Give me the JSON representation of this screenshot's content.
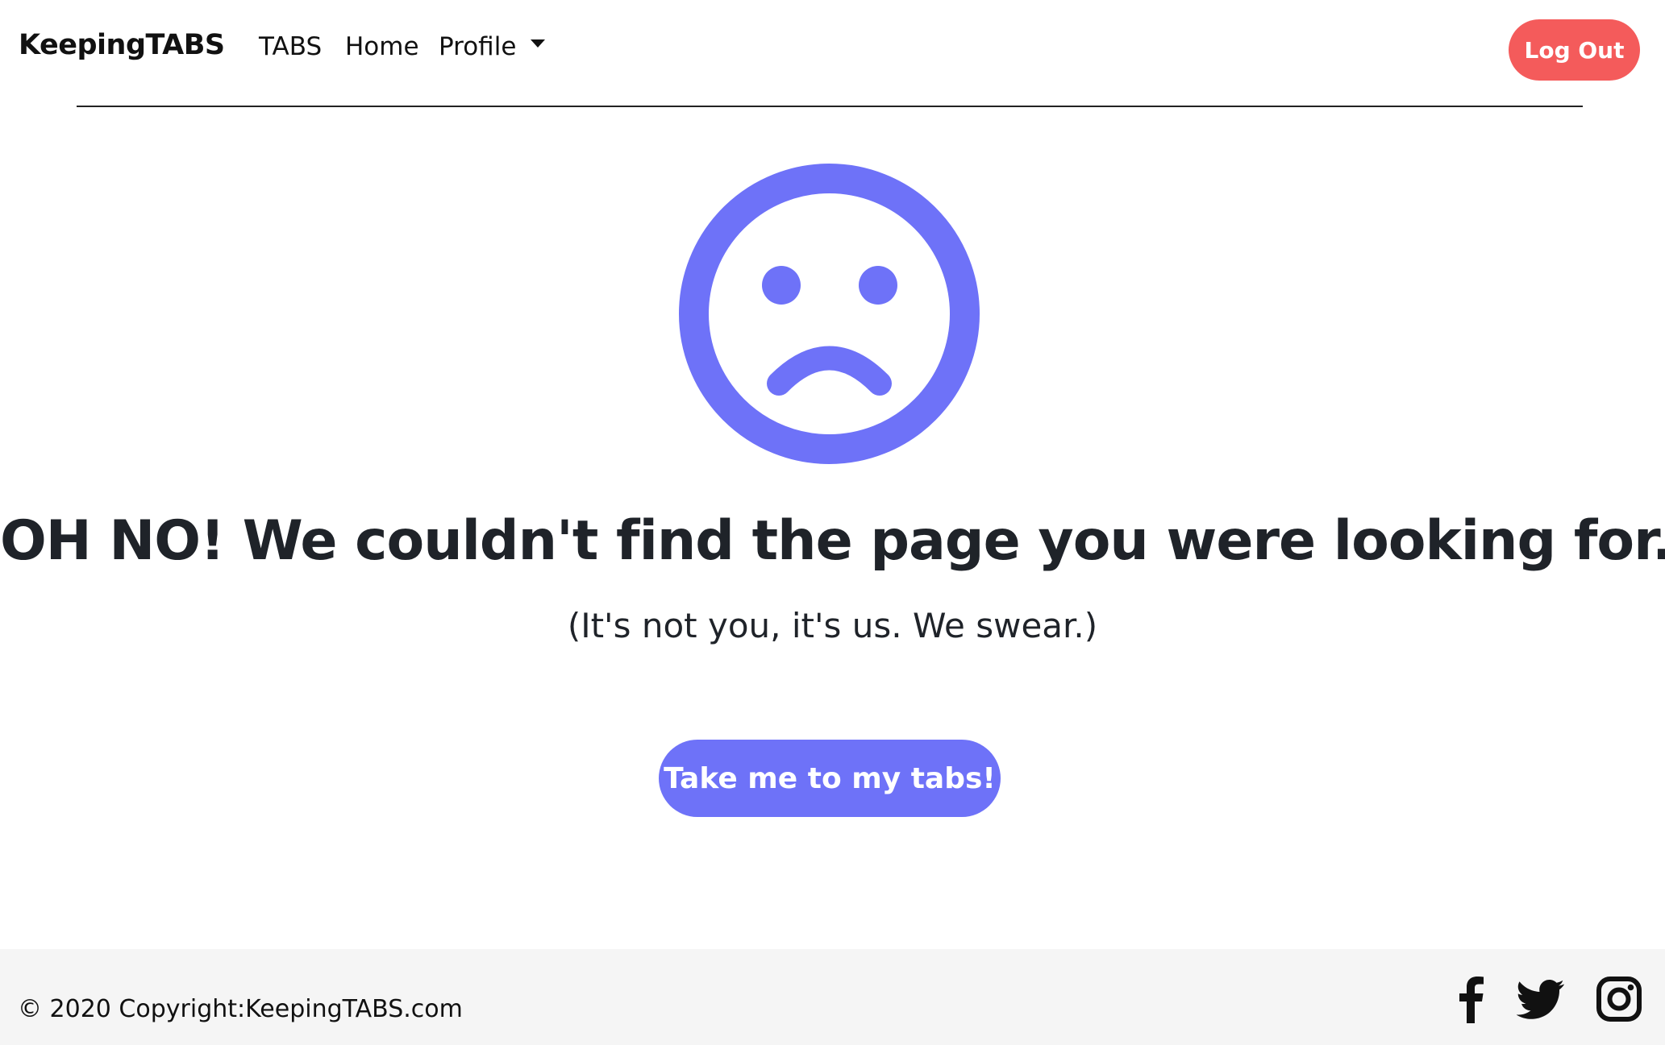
{
  "navbar": {
    "brand": "KeepingTABS",
    "links": [
      {
        "label": "TABS"
      },
      {
        "label": "Home"
      },
      {
        "label": "Profile"
      }
    ],
    "logout_label": "Log Out"
  },
  "error": {
    "icon": "sad-face-icon",
    "headline": "OH NO! We couldn't find the page you were looking for.",
    "subline": "(It's not you, it's us. We swear.)",
    "cta_label": "Take me to my tabs!"
  },
  "footer": {
    "copyright": "© 2020 Copyright:KeepingTABS.com",
    "social_icons": [
      "facebook-icon",
      "twitter-icon",
      "instagram-icon"
    ]
  },
  "colors": {
    "accent": "#6e72f8",
    "logout": "#f45b5b",
    "text": "#1f2329",
    "footer_bg": "#f5f5f5"
  }
}
